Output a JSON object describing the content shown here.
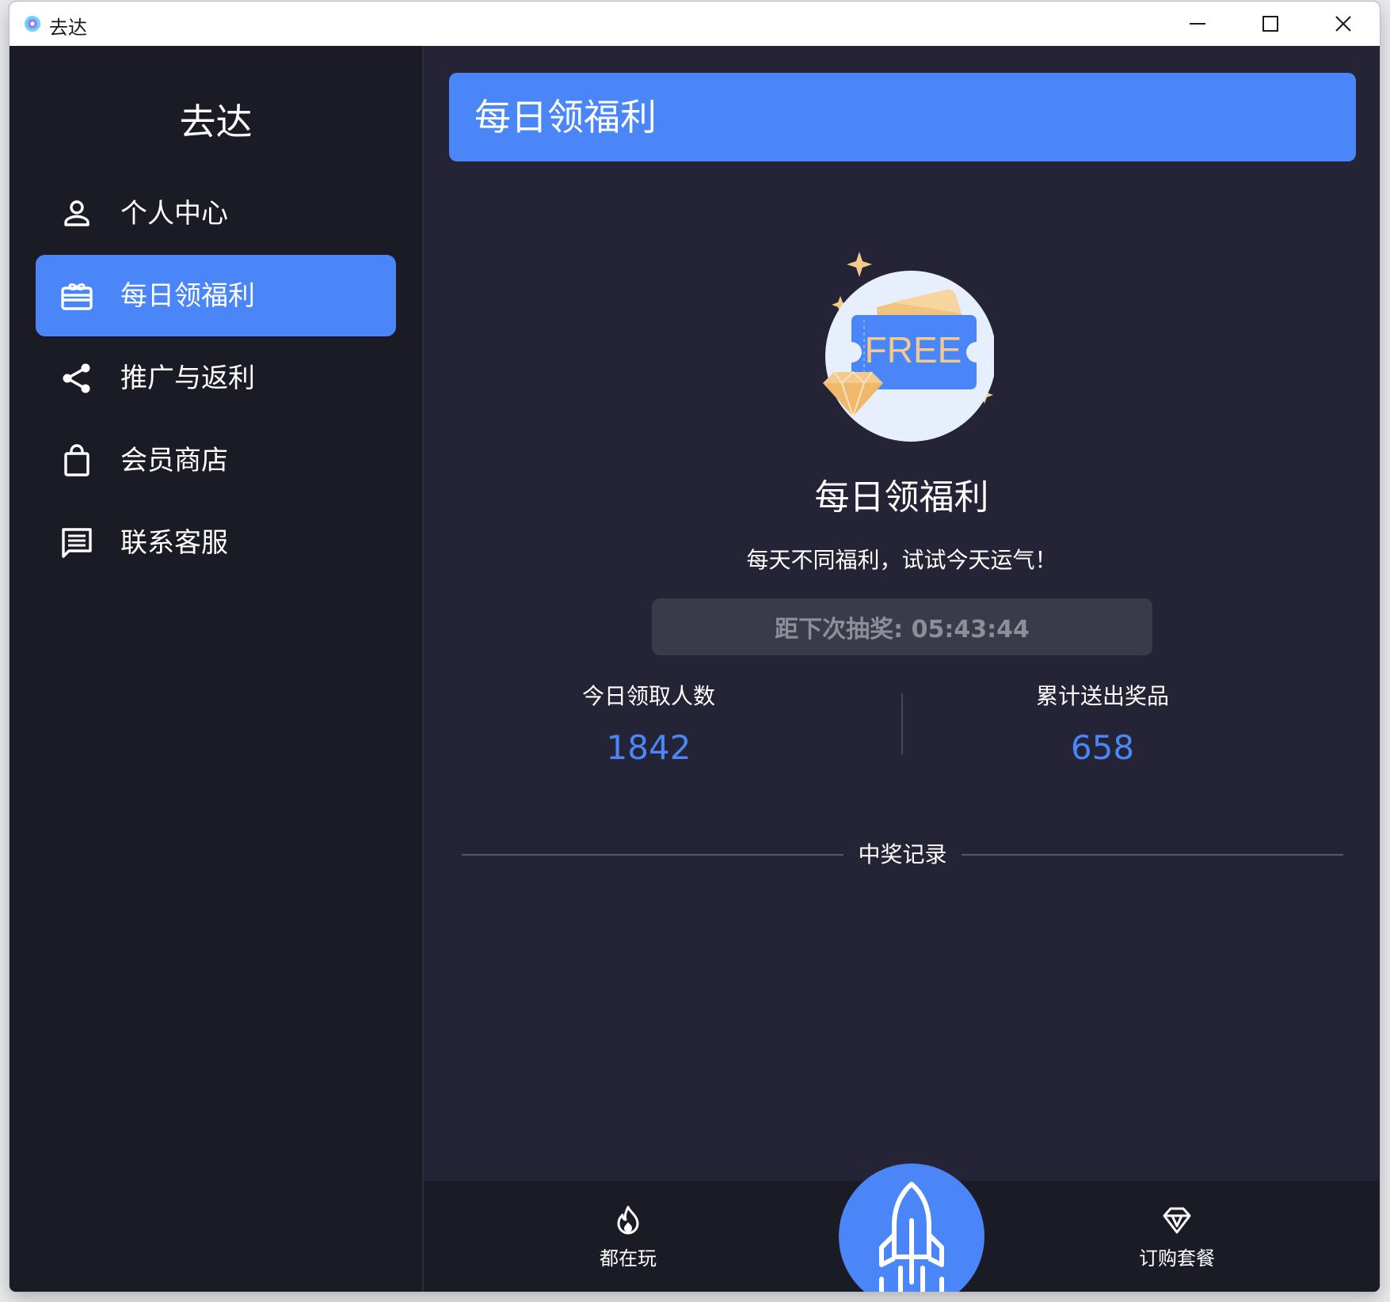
{
  "window": {
    "title": "去达",
    "controls": [
      "minimize",
      "maximize",
      "close"
    ]
  },
  "sidebar": {
    "brand": "去达",
    "items": [
      {
        "label": "个人中心",
        "icon": "user-icon",
        "active": false
      },
      {
        "label": "每日领福利",
        "icon": "gift-card-icon",
        "active": true
      },
      {
        "label": "推广与返利",
        "icon": "share-icon",
        "active": false
      },
      {
        "label": "会员商店",
        "icon": "shopping-bag-icon",
        "active": false
      },
      {
        "label": "联系客服",
        "icon": "message-icon",
        "active": false
      }
    ]
  },
  "main": {
    "header": "每日领福利",
    "hero": {
      "badge_text": "FREE"
    },
    "title": "每日领福利",
    "subtitle": "每天不同福利，试试今天运气！",
    "countdown": "距下次抽奖: 05:43:44",
    "stats": [
      {
        "label": "今日领取人数",
        "value": "1842"
      },
      {
        "label": "累计送出奖品",
        "value": "658"
      }
    ],
    "records_title": "中奖记录"
  },
  "bottom_nav": {
    "items": [
      {
        "label": "都在玩",
        "icon": "fire-icon"
      },
      {
        "label": "",
        "icon": "rocket-icon"
      },
      {
        "label": "订购套餐",
        "icon": "diamond-icon"
      }
    ]
  },
  "colors": {
    "accent": "#4a86f7",
    "sidebar_bg": "#1b1b26",
    "main_bg": "#242436",
    "countdown_bg": "#3a3a48",
    "countdown_text": "#8d8e99",
    "stat_value": "#4a86f7"
  }
}
